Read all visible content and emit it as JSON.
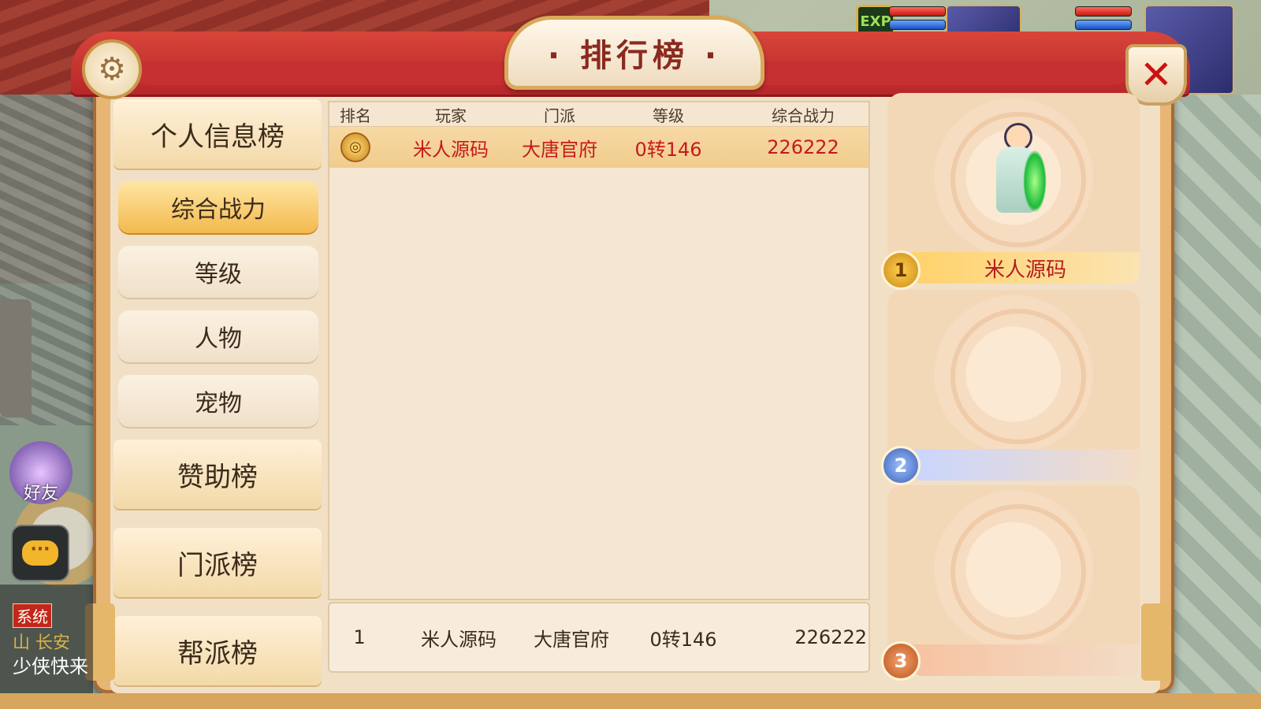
{
  "hud": {
    "exp_label": "EXP"
  },
  "panel": {
    "title": "· 排行榜 ·"
  },
  "nav": {
    "categories": [
      {
        "label": "个人信息榜"
      },
      {
        "label": "赞助榜"
      },
      {
        "label": "门派榜"
      },
      {
        "label": "帮派榜"
      }
    ],
    "subitems": [
      {
        "label": "综合战力",
        "active": true
      },
      {
        "label": "等级",
        "active": false
      },
      {
        "label": "人物",
        "active": false
      },
      {
        "label": "宠物",
        "active": false
      }
    ]
  },
  "table": {
    "headers": [
      "排名",
      "玩家",
      "门派",
      "等级",
      "综合战力"
    ],
    "rows": [
      {
        "player": "米人源码",
        "school": "大唐官府",
        "level": "0转146",
        "power": "226222"
      }
    ]
  },
  "my_rank": {
    "rank": "1",
    "player": "米人源码",
    "school": "大唐官府",
    "level": "0转146",
    "power": "226222"
  },
  "podium": [
    {
      "rank": "1",
      "name": "米人源码"
    },
    {
      "rank": "2",
      "name": ""
    },
    {
      "rank": "3",
      "name": ""
    }
  ],
  "sidebar": {
    "friend_label": "好友",
    "chat_icon": "···",
    "chat_channel": "系统",
    "chat_fragment": "山 长安",
    "chat_line": "少侠快来"
  }
}
